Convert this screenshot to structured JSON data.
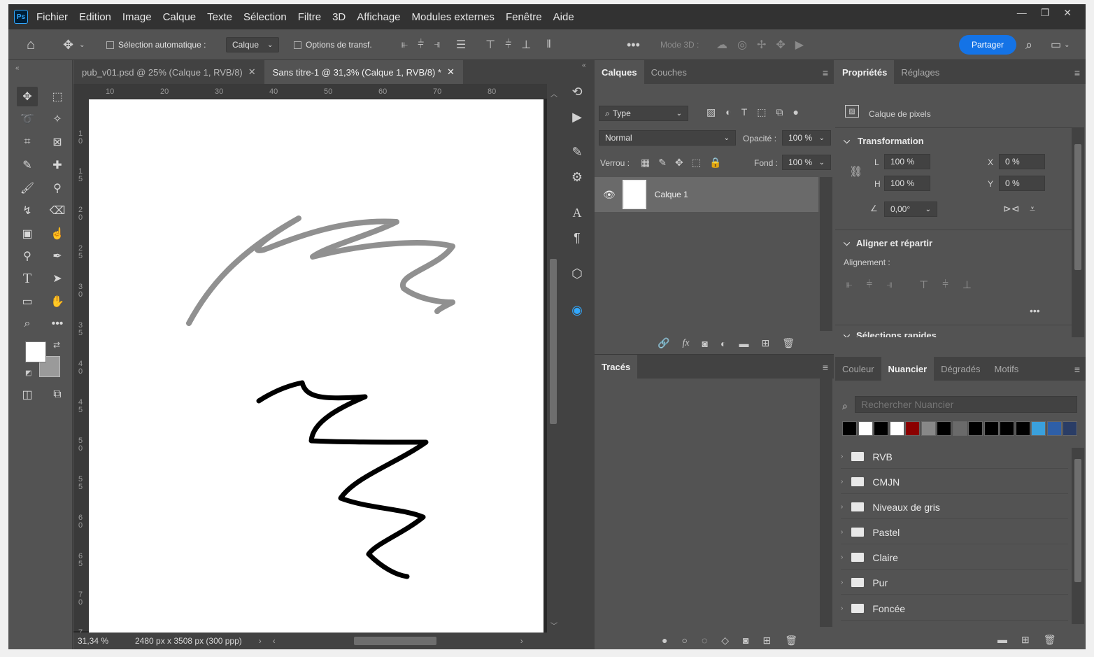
{
  "app": {
    "logo": "Ps",
    "menu": [
      "Fichier",
      "Edition",
      "Image",
      "Calque",
      "Texte",
      "Sélection",
      "Filtre",
      "3D",
      "Affichage",
      "Modules externes",
      "Fenêtre",
      "Aide"
    ]
  },
  "options": {
    "auto_select_label": "Sélection automatique :",
    "auto_select_value": "Calque",
    "transform_label": "Options de transf.",
    "mode3d_label": "Mode 3D :",
    "share_label": "Partager"
  },
  "tabs": [
    {
      "label": "pub_v01.psd @ 25% (Calque 1, RVB/8)",
      "close": "✕"
    },
    {
      "label": "Sans titre-1 @ 31,3% (Calque 1, RVB/8) *",
      "close": "✕"
    }
  ],
  "ruler": {
    "h": [
      "10",
      "20",
      "30",
      "40",
      "50",
      "60",
      "70",
      "80"
    ],
    "v": [
      "1\n0",
      "1\n5",
      "2\n0",
      "2\n5",
      "3\n0",
      "3\n5",
      "4\n0",
      "4\n5",
      "5\n0",
      "5\n5",
      "6\n0",
      "6\n5",
      "7\n0",
      "7"
    ]
  },
  "status": {
    "zoom": "31,34 %",
    "doc_size": "2480 px x 3508 px (300 ppp)"
  },
  "layers_panel": {
    "tabs": [
      "Calques",
      "Couches"
    ],
    "filter": "Type",
    "blend_mode": "Normal",
    "opacity_label": "Opacité :",
    "opacity_value": "100 %",
    "lock_label": "Verrou :",
    "fill_label": "Fond :",
    "fill_value": "100 %",
    "layer_name": "Calque 1",
    "fx_label": "fx"
  },
  "paths_panel": {
    "title": "Tracés"
  },
  "properties": {
    "tabs": [
      "Propriétés",
      "Réglages"
    ],
    "layer_type": "Calque de pixels",
    "transform_title": "Transformation",
    "L_label": "L",
    "L_value": "100 %",
    "H_label": "H",
    "H_value": "100 %",
    "X_label": "X",
    "X_value": "0 %",
    "Y_label": "Y",
    "Y_value": "0 %",
    "angle_value": "0,00°",
    "align_title": "Aligner et répartir",
    "align_label": "Alignement :",
    "quick_title": "Sélections rapides"
  },
  "swatches": {
    "tabs": [
      "Couleur",
      "Nuancier",
      "Dégradés",
      "Motifs"
    ],
    "search_placeholder": "Rechercher Nuancier",
    "colors": [
      "#000000",
      "#ffffff",
      "#000000",
      "#ffffff",
      "#8b0000",
      "#888888",
      "#000000",
      "#6a6a6a",
      "#000000",
      "#000000",
      "#000000",
      "#000000",
      "#3aa0dc",
      "#2e5fa8",
      "#2a3d66"
    ],
    "groups": [
      "RVB",
      "CMJN",
      "Niveaux de gris",
      "Pastel",
      "Claire",
      "Pur",
      "Foncée"
    ]
  }
}
